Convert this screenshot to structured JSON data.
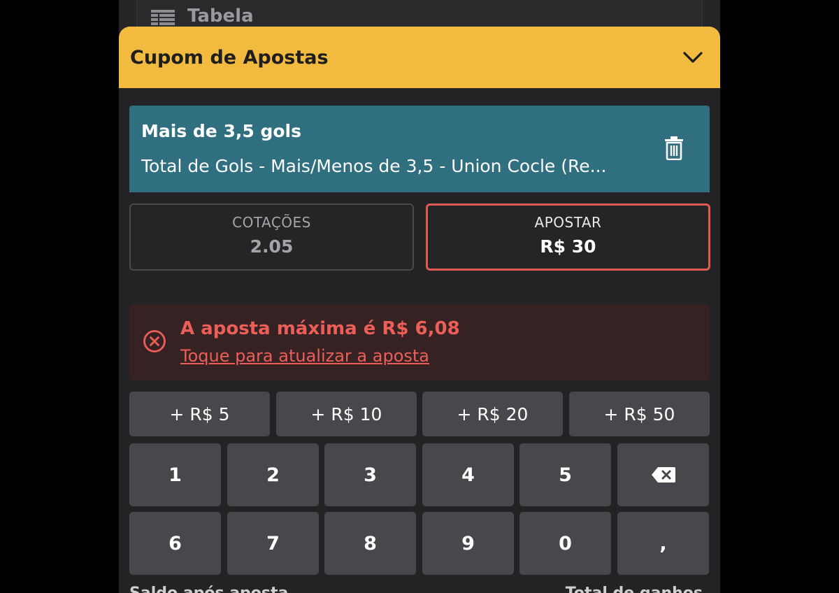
{
  "background": {
    "label": "Tabela",
    "icon": "table-icon"
  },
  "sheet": {
    "title": "Cupom de Apostas",
    "collapse_icon": "chevron-down-icon",
    "accent_color": "#f2ba3e"
  },
  "selection": {
    "title": "Mais de 3,5 gols",
    "description": "Total de Gols - Mais/Menos de 3,5 - Union Cocle (Re...",
    "delete_icon": "trash-icon",
    "card_color": "#2f6f80"
  },
  "odds": {
    "label": "COTAÇÕES",
    "value": "2.05"
  },
  "stake": {
    "label": "APOSTAR",
    "value": "R$ 30",
    "border_color": "#e05a55"
  },
  "error": {
    "icon": "close-circle-icon",
    "message": "A aposta máxima é R$ 6,08",
    "action": "Toque para atualizar a aposta",
    "color": "#ec5f58"
  },
  "quick_amounts": [
    "+ R$ 5",
    "+ R$ 10",
    "+ R$ 20",
    "+ R$ 50"
  ],
  "keypad": {
    "row1": [
      "1",
      "2",
      "3",
      "4",
      "5"
    ],
    "backspace_icon": "backspace-icon",
    "row2": [
      "6",
      "7",
      "8",
      "9",
      "0",
      ","
    ]
  },
  "footer": {
    "left": "Saldo após aposta",
    "right": "Total de ganhos"
  }
}
